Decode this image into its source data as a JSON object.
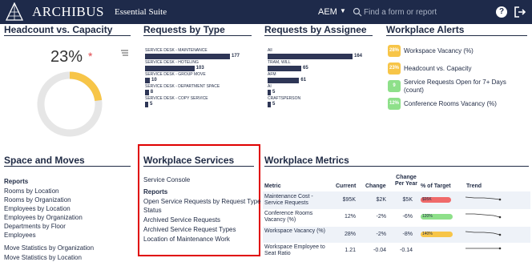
{
  "header": {
    "app_name": "ARCHIBUS",
    "suite": "Essential Suite",
    "project": "AEM",
    "search_placeholder": "Find a form or report",
    "help_label": "?"
  },
  "colors": {
    "topbar": "#1e2a4a",
    "accent_yellow": "#f7c548",
    "alert_green": "#8ee08a",
    "alert_yellow": "#f7c548",
    "pill_red": "#f06a6a",
    "bar_navy": "#2e3656",
    "highlight_red": "#e00000"
  },
  "headcount": {
    "title": "Headcount vs. Capacity",
    "percent": "23%",
    "star": "*",
    "gauge_fraction": 0.23
  },
  "requests_by_type": {
    "title": "Requests by Type",
    "chart_data": {
      "type": "bar",
      "categories": [
        "SERVICE DESK - MAINTENANCE",
        "SERVICE DESK - HOTELING",
        "SERVICE DESK - GROUP MOVE",
        "SERVICE DESK - DEPARTMENT SPACE",
        "SERVICE DESK - COPY SERVICE"
      ],
      "values": [
        177,
        103,
        10,
        8,
        5
      ]
    }
  },
  "requests_by_assignee": {
    "title": "Requests by Assignee",
    "chart_data": {
      "type": "bar",
      "categories": [
        "All",
        "TRAM, WILL",
        "AFM",
        "AI",
        "CRAFTSPERSON"
      ],
      "values": [
        164,
        65,
        61,
        5,
        5
      ]
    }
  },
  "workplace_alerts": {
    "title": "Workplace Alerts",
    "items": [
      {
        "value": "28%",
        "label": "Workspace Vacancy (%)",
        "color": "#f7c548"
      },
      {
        "value": "23%",
        "label": "Headcount vs. Capacity",
        "color": "#f7c548"
      },
      {
        "value": "9",
        "label": "Service Requests Open for 7+ Days (count)",
        "color": "#8ee08a"
      },
      {
        "value": "12%",
        "label": "Conference Rooms Vacancy (%)",
        "color": "#8ee08a"
      }
    ]
  },
  "space_and_moves": {
    "title": "Space and Moves",
    "reports_label": "Reports",
    "items": [
      "Rooms by Location",
      "Rooms by Organization",
      "Employees by Location",
      "Employees by Organization",
      "Departments by Floor",
      "Employees",
      "Move Statistics by Organization",
      "Move Statistics by Location"
    ]
  },
  "workplace_services": {
    "title": "Workplace Services",
    "console": "Service Console",
    "reports_label": "Reports",
    "items": [
      "Open Service Requests by Request Type and",
      "Status",
      "Archived Service Requests",
      "Archived Service Request Types",
      "Location of Maintenance Work"
    ]
  },
  "workplace_metrics": {
    "title": "Workplace Metrics",
    "columns": [
      "Metric",
      "Current",
      "Change",
      "Change Per Year",
      "% of Target",
      "Trend"
    ],
    "rows": [
      {
        "metric": "Maintenance Cost - Service Requests",
        "current": "$95K",
        "change": "$2K",
        "change_per_year": "$5K",
        "target": "$95K",
        "target_pct": 0.95,
        "target_color": "#f06a6a"
      },
      {
        "metric": "Conference Rooms Vacancy (%)",
        "current": "12%",
        "change": "-2%",
        "change_per_year": "-6%",
        "target": "120%",
        "target_pct": 1.0,
        "target_color": "#8ee08a"
      },
      {
        "metric": "Workspace Vacancy (%)",
        "current": "28%",
        "change": "-2%",
        "change_per_year": "-8%",
        "target": "140%",
        "target_pct": 1.0,
        "target_color": "#f7c548"
      },
      {
        "metric": "Workspace Employee to Seat Ratio",
        "current": "1.21",
        "change": "-0.04",
        "change_per_year": "-0.14",
        "target": "",
        "target_pct": 0,
        "target_color": ""
      }
    ]
  }
}
